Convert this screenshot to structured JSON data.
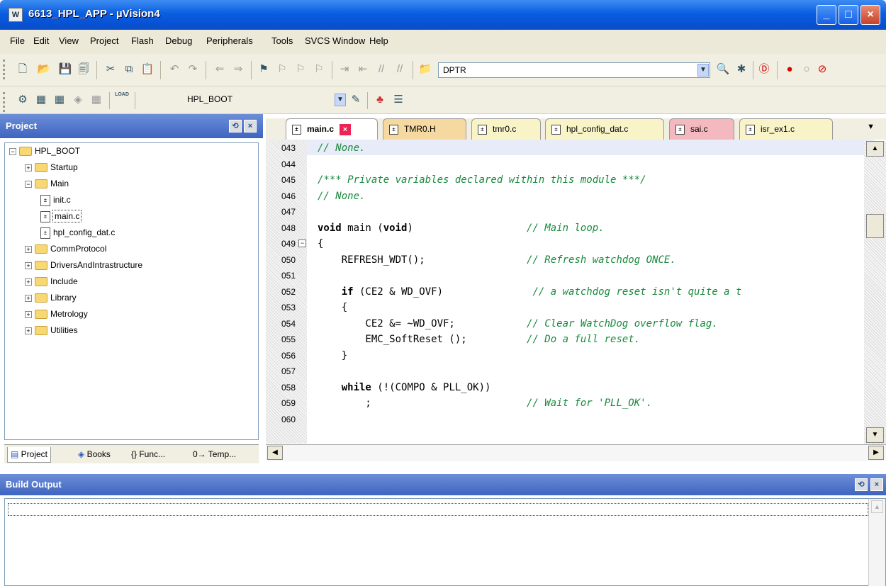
{
  "window": {
    "title": "6613_HPL_APP  - µVision4",
    "app_icon": "W"
  },
  "menu": [
    "File",
    "Edit",
    "View",
    "Project",
    "Flash",
    "Debug",
    "Peripherals",
    "Tools",
    "SVCS",
    "Window",
    "Help"
  ],
  "toolbar1": {
    "search_combo": "DPTR"
  },
  "toolbar2": {
    "target_combo": "HPL_BOOT",
    "load_label": "LOAD"
  },
  "project_panel": {
    "title": "Project",
    "tree": [
      {
        "label": "HPL_BOOT",
        "level": 0,
        "type": "root",
        "expander": "−"
      },
      {
        "label": "Startup",
        "level": 1,
        "type": "folder",
        "expander": "+"
      },
      {
        "label": "Main",
        "level": 1,
        "type": "folder-open",
        "expander": "−"
      },
      {
        "label": "init.c",
        "level": 2,
        "type": "file"
      },
      {
        "label": "main.c",
        "level": 2,
        "type": "file",
        "selected": true
      },
      {
        "label": "hpl_config_dat.c",
        "level": 2,
        "type": "file"
      },
      {
        "label": "CommProtocol",
        "level": 1,
        "type": "folder",
        "expander": "+"
      },
      {
        "label": "DriversAndIntrastructure",
        "level": 1,
        "type": "folder",
        "expander": "+"
      },
      {
        "label": "Include",
        "level": 1,
        "type": "folder",
        "expander": "+"
      },
      {
        "label": "Library",
        "level": 1,
        "type": "folder",
        "expander": "+"
      },
      {
        "label": "Metrology",
        "level": 1,
        "type": "folder",
        "expander": "+"
      },
      {
        "label": "Utilities",
        "level": 1,
        "type": "folder",
        "expander": "+"
      }
    ],
    "tabs": [
      "Project",
      "Books",
      "{} Func...",
      "0→ Temp..."
    ]
  },
  "editor": {
    "tabs": [
      {
        "label": "main.c",
        "active": true,
        "color": "#f8f4c8"
      },
      {
        "label": "TMR0.H",
        "color": "#f5d9a0"
      },
      {
        "label": "tmr0.c",
        "color": "#f8f4c8"
      },
      {
        "label": "hpl_config_dat.c",
        "color": "#f8f4c8"
      },
      {
        "label": "sai.c",
        "color": "#f4b8bf"
      },
      {
        "label": "isr_ex1.c",
        "color": "#f8f4c8"
      }
    ],
    "lines": [
      {
        "num": "043",
        "code": [
          {
            "t": "// None.",
            "c": "cm"
          }
        ]
      },
      {
        "num": "044",
        "code": []
      },
      {
        "num": "045",
        "code": [
          {
            "t": "/*** Private variables declared within this module ***/",
            "c": "cm"
          }
        ]
      },
      {
        "num": "046",
        "code": [
          {
            "t": "// None.",
            "c": "cm"
          }
        ]
      },
      {
        "num": "047",
        "code": []
      },
      {
        "num": "048",
        "code": [
          {
            "t": "void",
            "c": "kw"
          },
          {
            "t": " main ("
          },
          {
            "t": "void",
            "c": "kw"
          },
          {
            "t": ")                   "
          },
          {
            "t": "// Main loop.",
            "c": "cm"
          }
        ]
      },
      {
        "num": "049",
        "code": [
          {
            "t": "{"
          }
        ]
      },
      {
        "num": "050",
        "code": [
          {
            "t": "    REFRESH_WDT();                 "
          },
          {
            "t": "// Refresh watchdog ONCE.",
            "c": "cm"
          }
        ]
      },
      {
        "num": "051",
        "code": []
      },
      {
        "num": "052",
        "code": [
          {
            "t": "    "
          },
          {
            "t": "if",
            "c": "kw"
          },
          {
            "t": " (CE2 & WD_OVF)               "
          },
          {
            "t": "// a watchdog reset isn't quite a t",
            "c": "cm"
          }
        ]
      },
      {
        "num": "053",
        "code": [
          {
            "t": "    {"
          }
        ]
      },
      {
        "num": "054",
        "code": [
          {
            "t": "        CE2 &= ~WD_OVF;            "
          },
          {
            "t": "// Clear WatchDog overflow flag.",
            "c": "cm"
          }
        ]
      },
      {
        "num": "055",
        "code": [
          {
            "t": "        EMC_SoftReset ();          "
          },
          {
            "t": "// Do a full reset.",
            "c": "cm"
          }
        ]
      },
      {
        "num": "056",
        "code": [
          {
            "t": "    }"
          }
        ]
      },
      {
        "num": "057",
        "code": []
      },
      {
        "num": "058",
        "code": [
          {
            "t": "    "
          },
          {
            "t": "while",
            "c": "kw"
          },
          {
            "t": " (!(COMPO & PLL_OK))"
          }
        ]
      },
      {
        "num": "059",
        "code": [
          {
            "t": "        ;                          "
          },
          {
            "t": "// Wait for 'PLL_OK'.",
            "c": "cm"
          }
        ]
      },
      {
        "num": "060",
        "code": []
      }
    ]
  },
  "build_output": {
    "title": "Build Output"
  }
}
